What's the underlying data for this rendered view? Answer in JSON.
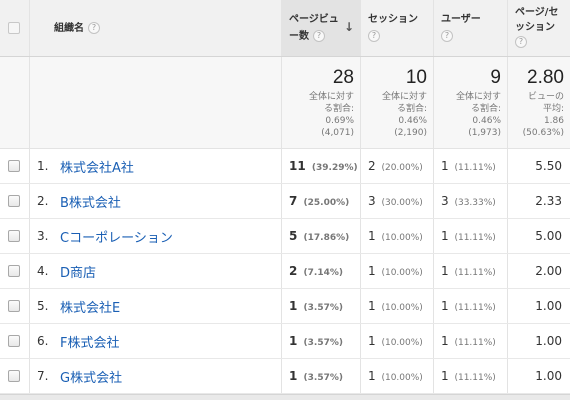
{
  "header": {
    "name_label": "組織名",
    "pageviews_label_1": "ページビュ",
    "pageviews_label_2": "ー数",
    "sessions_label": "セッション",
    "users_label": "ユーザー",
    "pps_label_1": "ページ/セ",
    "pps_label_2": "ッション",
    "help_glyph": "?",
    "sort_glyph": "↓"
  },
  "totals": {
    "pageviews": {
      "value": "28",
      "sub": "全体に対す\nる割合:\n0.69%\n(4,071)"
    },
    "sessions": {
      "value": "10",
      "sub": "全体に対す\nる割合:\n0.46%\n(2,190)"
    },
    "users": {
      "value": "9",
      "sub": "全体に対す\nる割合:\n0.46%\n(1,973)"
    },
    "pps": {
      "value": "2.80",
      "sub": "ビューの\n平均:\n1.86\n(50.63%)"
    }
  },
  "rows": [
    {
      "num": "1.",
      "name": "株式会社A社",
      "pv": "11",
      "pv_pct": "(39.29%)",
      "ses": "2",
      "ses_pct": "(20.00%)",
      "usr": "1",
      "usr_pct": "(11.11%)",
      "pps": "5.50"
    },
    {
      "num": "2.",
      "name": "B株式会社",
      "pv": "7",
      "pv_pct": "(25.00%)",
      "ses": "3",
      "ses_pct": "(30.00%)",
      "usr": "3",
      "usr_pct": "(33.33%)",
      "pps": "2.33"
    },
    {
      "num": "3.",
      "name": "Cコーポレーション",
      "pv": "5",
      "pv_pct": "(17.86%)",
      "ses": "1",
      "ses_pct": "(10.00%)",
      "usr": "1",
      "usr_pct": "(11.11%)",
      "pps": "5.00"
    },
    {
      "num": "4.",
      "name": "D商店",
      "pv": "2",
      "pv_pct": "(7.14%)",
      "ses": "1",
      "ses_pct": "(10.00%)",
      "usr": "1",
      "usr_pct": "(11.11%)",
      "pps": "2.00"
    },
    {
      "num": "5.",
      "name": "株式会社E",
      "pv": "1",
      "pv_pct": "(3.57%)",
      "ses": "1",
      "ses_pct": "(10.00%)",
      "usr": "1",
      "usr_pct": "(11.11%)",
      "pps": "1.00"
    },
    {
      "num": "6.",
      "name": "F株式会社",
      "pv": "1",
      "pv_pct": "(3.57%)",
      "ses": "1",
      "ses_pct": "(10.00%)",
      "usr": "1",
      "usr_pct": "(11.11%)",
      "pps": "1.00"
    },
    {
      "num": "7.",
      "name": "G株式会社",
      "pv": "1",
      "pv_pct": "(3.57%)",
      "ses": "1",
      "ses_pct": "(10.00%)",
      "usr": "1",
      "usr_pct": "(11.11%)",
      "pps": "1.00"
    }
  ]
}
